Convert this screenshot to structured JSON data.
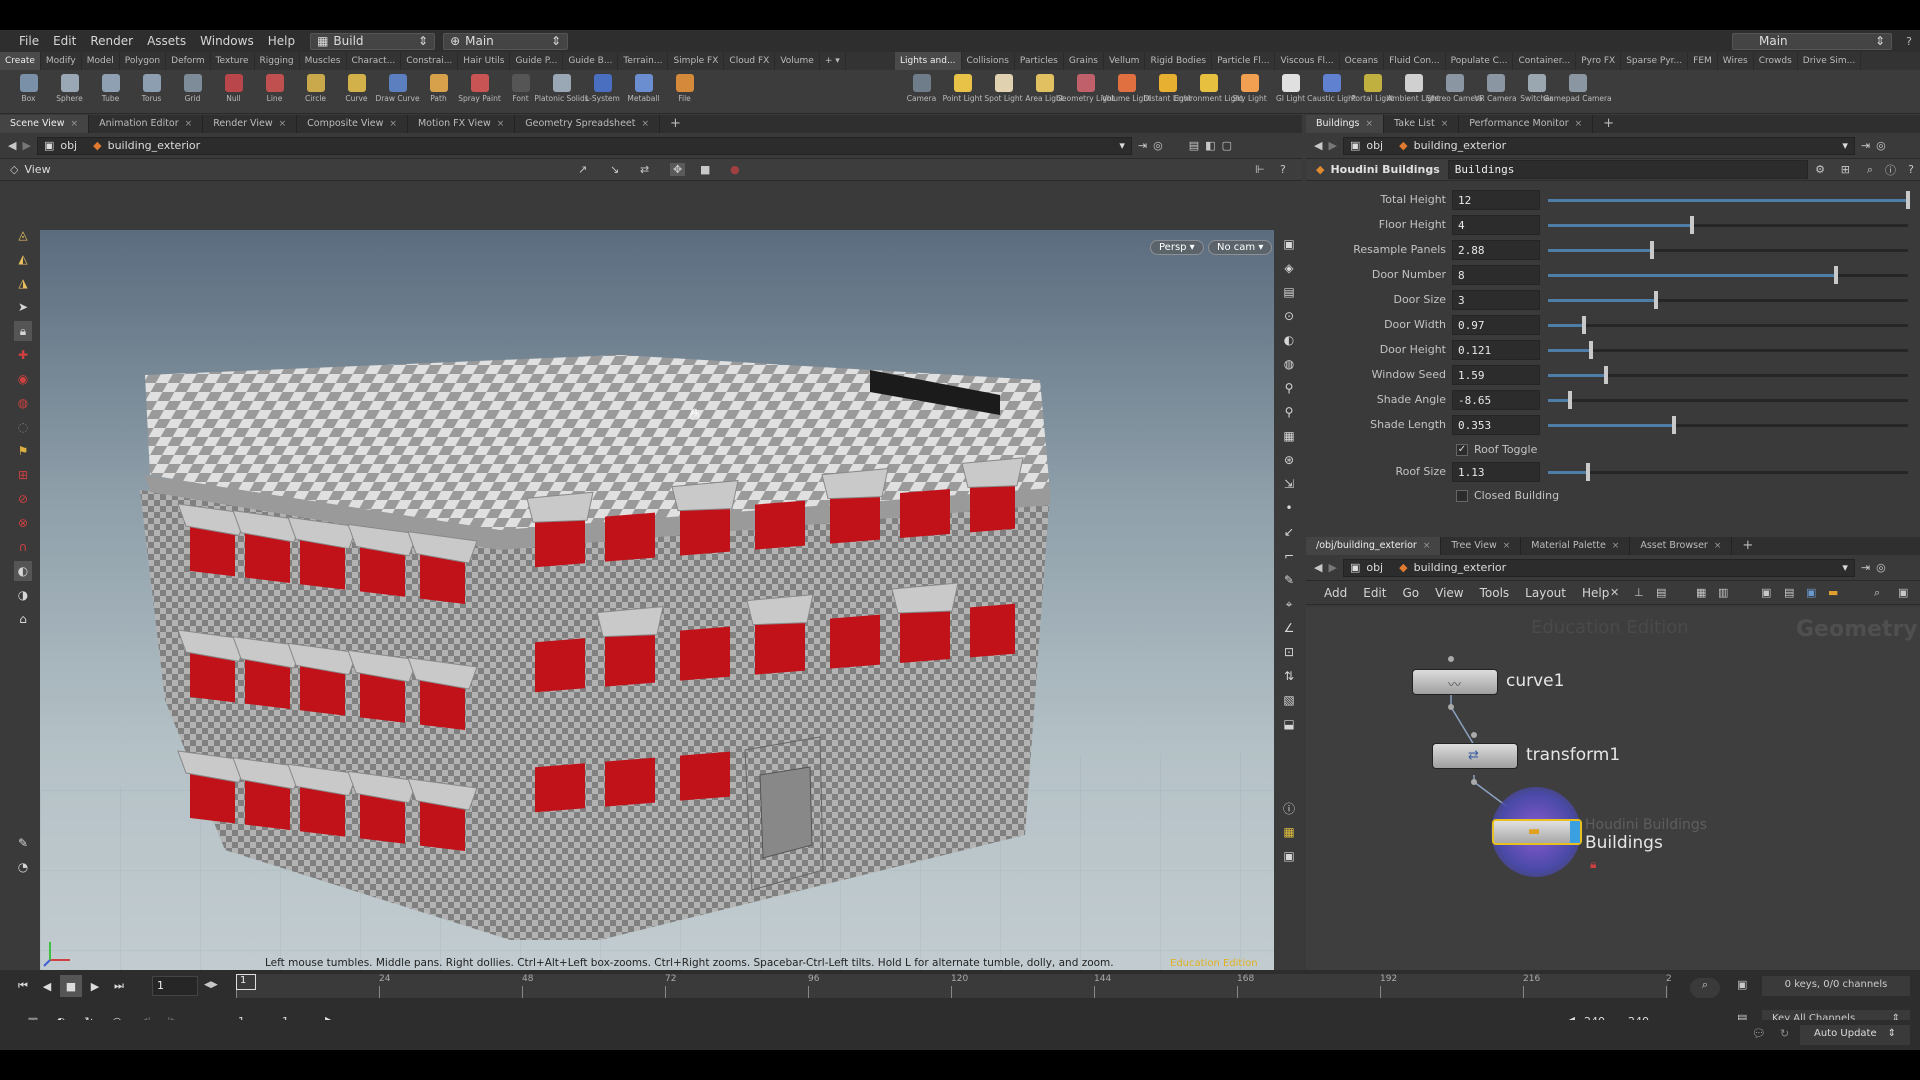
{
  "menubar": {
    "items": [
      "File",
      "Edit",
      "Render",
      "Assets",
      "Windows",
      "Help"
    ],
    "desktop": "Build",
    "context": "Main",
    "right_context": "Main"
  },
  "shelf": {
    "left_tabs": [
      "Create",
      "Modify",
      "Model",
      "Polygon",
      "Deform",
      "Texture",
      "Rigging",
      "Muscles",
      "Charact...",
      "Constrai...",
      "Hair Utils",
      "Guide P...",
      "Guide B...",
      "Terrain...",
      "Simple FX",
      "Cloud FX",
      "Volume"
    ],
    "right_tabs": [
      "Lights and...",
      "Collisions",
      "Particles",
      "Grains",
      "Vellum",
      "Rigid Bodies",
      "Particle Fl...",
      "Viscous Fl...",
      "Oceans",
      "Fluid Con...",
      "Populate C...",
      "Container...",
      "Pyro FX",
      "Sparse Pyr...",
      "FEM",
      "Wires",
      "Crowds",
      "Drive Sim..."
    ],
    "left_tools": [
      {
        "label": "Box",
        "icon": "box-icon",
        "color": "#7a8fa8"
      },
      {
        "label": "Sphere",
        "icon": "sphere-icon",
        "color": "#9aa7b5"
      },
      {
        "label": "Tube",
        "icon": "tube-icon",
        "color": "#8fa0b2"
      },
      {
        "label": "Torus",
        "icon": "torus-icon",
        "color": "#8d9eb0"
      },
      {
        "label": "Grid",
        "icon": "grid-icon",
        "color": "#7e8c9a"
      },
      {
        "label": "Null",
        "icon": "null-icon",
        "color": "#b8464a"
      },
      {
        "label": "Line",
        "icon": "line-icon",
        "color": "#c05050"
      },
      {
        "label": "Circle",
        "icon": "circle-icon",
        "color": "#c9a94c"
      },
      {
        "label": "Curve",
        "icon": "curve-icon",
        "color": "#d2b04a"
      },
      {
        "label": "Draw Curve",
        "icon": "draw-curve-icon",
        "color": "#5b7fbf"
      },
      {
        "label": "Path",
        "icon": "path-icon",
        "color": "#d6a14a"
      },
      {
        "label": "Spray Paint",
        "icon": "spray-paint-icon",
        "color": "#c85454"
      },
      {
        "label": "Font",
        "icon": "font-icon",
        "color": "#555555"
      },
      {
        "label": "Platonic Solids",
        "icon": "platonic-icon",
        "color": "#9aa7b5"
      },
      {
        "label": "L-System",
        "icon": "lsystem-icon",
        "color": "#4a6fc0"
      },
      {
        "label": "Metaball",
        "icon": "metaball-icon",
        "color": "#6a8ed0"
      },
      {
        "label": "File",
        "icon": "file-icon",
        "color": "#d48a3a"
      }
    ],
    "right_tools": [
      {
        "label": "Camera",
        "icon": "camera-icon",
        "color": "#6f7c8a"
      },
      {
        "label": "Point Light",
        "icon": "point-light-icon",
        "color": "#e8c247"
      },
      {
        "label": "Spot Light",
        "icon": "spot-light-icon",
        "color": "#e0d2b0"
      },
      {
        "label": "Area Light",
        "icon": "area-light-icon",
        "color": "#e0c060"
      },
      {
        "label": "Geometry Light",
        "icon": "geometry-light-icon",
        "color": "#c0606a"
      },
      {
        "label": "Volume Light",
        "icon": "volume-light-icon",
        "color": "#e07040"
      },
      {
        "label": "Distant Light",
        "icon": "distant-light-icon",
        "color": "#e8b030"
      },
      {
        "label": "Environment Light",
        "icon": "environment-light-icon",
        "color": "#e8c040"
      },
      {
        "label": "Sky Light",
        "icon": "sky-light-icon",
        "color": "#f0a050"
      },
      {
        "label": "GI Light",
        "icon": "gi-light-icon",
        "color": "#e0e0e0"
      },
      {
        "label": "Caustic Light",
        "icon": "caustic-light-icon",
        "color": "#6080d0"
      },
      {
        "label": "Portal Light",
        "icon": "portal-light-icon",
        "color": "#c0b040"
      },
      {
        "label": "Ambient Light",
        "icon": "ambient-light-icon",
        "color": "#d0d0d0"
      },
      {
        "label": "Stereo Camera",
        "icon": "stereo-camera-icon",
        "color": "#8a96a2"
      },
      {
        "label": "VR Camera",
        "icon": "vr-camera-icon",
        "color": "#8a96a2"
      },
      {
        "label": "Switcher",
        "icon": "switcher-icon",
        "color": "#9aa6b0"
      },
      {
        "label": "Gamepad Camera",
        "icon": "gamepad-camera-icon",
        "color": "#8a96a2"
      }
    ]
  },
  "scene": {
    "tabs": [
      "Scene View",
      "Animation Editor",
      "Render View",
      "Composite View",
      "Motion FX View",
      "Geometry Spreadsheet"
    ],
    "path_root": "obj",
    "path_node": "building_exterior",
    "view_label": "View",
    "persp": "Persp ▾",
    "cam": "No cam ▾",
    "hint": "Left mouse tumbles. Middle pans. Right dollies. Ctrl+Alt+Left box-zooms. Ctrl+Right zooms. Spacebar-Ctrl-Left tilts. Hold L for alternate tumble, dolly, and zoom.",
    "watermark": "Education Edition"
  },
  "params": {
    "tabs": [
      "Buildings",
      "Take List",
      "Performance Monitor"
    ],
    "path_root": "obj",
    "path_node": "building_exterior",
    "asset_type": "Houdini Buildings",
    "asset_name": "Buildings",
    "rows": [
      {
        "label": "Total Height",
        "value": "12",
        "fraction": 1.0
      },
      {
        "label": "Floor Height",
        "value": "4",
        "fraction": 0.4
      },
      {
        "label": "Resample Panels",
        "value": "2.88",
        "fraction": 0.29
      },
      {
        "label": "Door Number",
        "value": "8",
        "fraction": 0.8
      },
      {
        "label": "Door Size",
        "value": "3",
        "fraction": 0.3
      },
      {
        "label": "Door Width",
        "value": "0.97",
        "fraction": 0.1
      },
      {
        "label": "Door Height",
        "value": "0.121",
        "fraction": 0.12
      },
      {
        "label": "Window Seed",
        "value": "1.59",
        "fraction": 0.16
      },
      {
        "label": "Shade Angle",
        "value": "-8.65",
        "fraction": 0.06
      },
      {
        "label": "Shade Length",
        "value": "0.353",
        "fraction": 0.35
      }
    ],
    "roof_toggle": {
      "label": "Roof Toggle",
      "checked": true
    },
    "roof_size": {
      "label": "Roof Size",
      "value": "1.13",
      "fraction": 0.11
    },
    "closed_building": {
      "label": "Closed Building",
      "checked": false
    }
  },
  "network": {
    "tabs": [
      "/obj/building_exterior",
      "Tree View",
      "Material Palette",
      "Asset Browser"
    ],
    "path_root": "obj",
    "path_node": "building_exterior",
    "menu": [
      "Add",
      "Edit",
      "Go",
      "View",
      "Tools",
      "Layout",
      "Help"
    ],
    "watermark": "Education Edition",
    "context_label": "Geometry",
    "nodes": [
      {
        "name": "curve1"
      },
      {
        "name": "transform1"
      }
    ],
    "hda": {
      "type": "Houdini Buildings",
      "name": "Buildings"
    }
  },
  "timeline": {
    "ticks": [
      "1",
      "24",
      "48",
      "72",
      "96",
      "120",
      "144",
      "168",
      "192",
      "216",
      "2"
    ],
    "current_frame": "1",
    "start": "1",
    "start2": "1",
    "end": "240",
    "end2": "240",
    "keys": "0 keys, 0/0 channels",
    "key_all": "Key All Channels",
    "auto_update": "Auto Update"
  },
  "colors": {
    "accent": "#4e7ea8",
    "window_red": "#c1121a"
  }
}
